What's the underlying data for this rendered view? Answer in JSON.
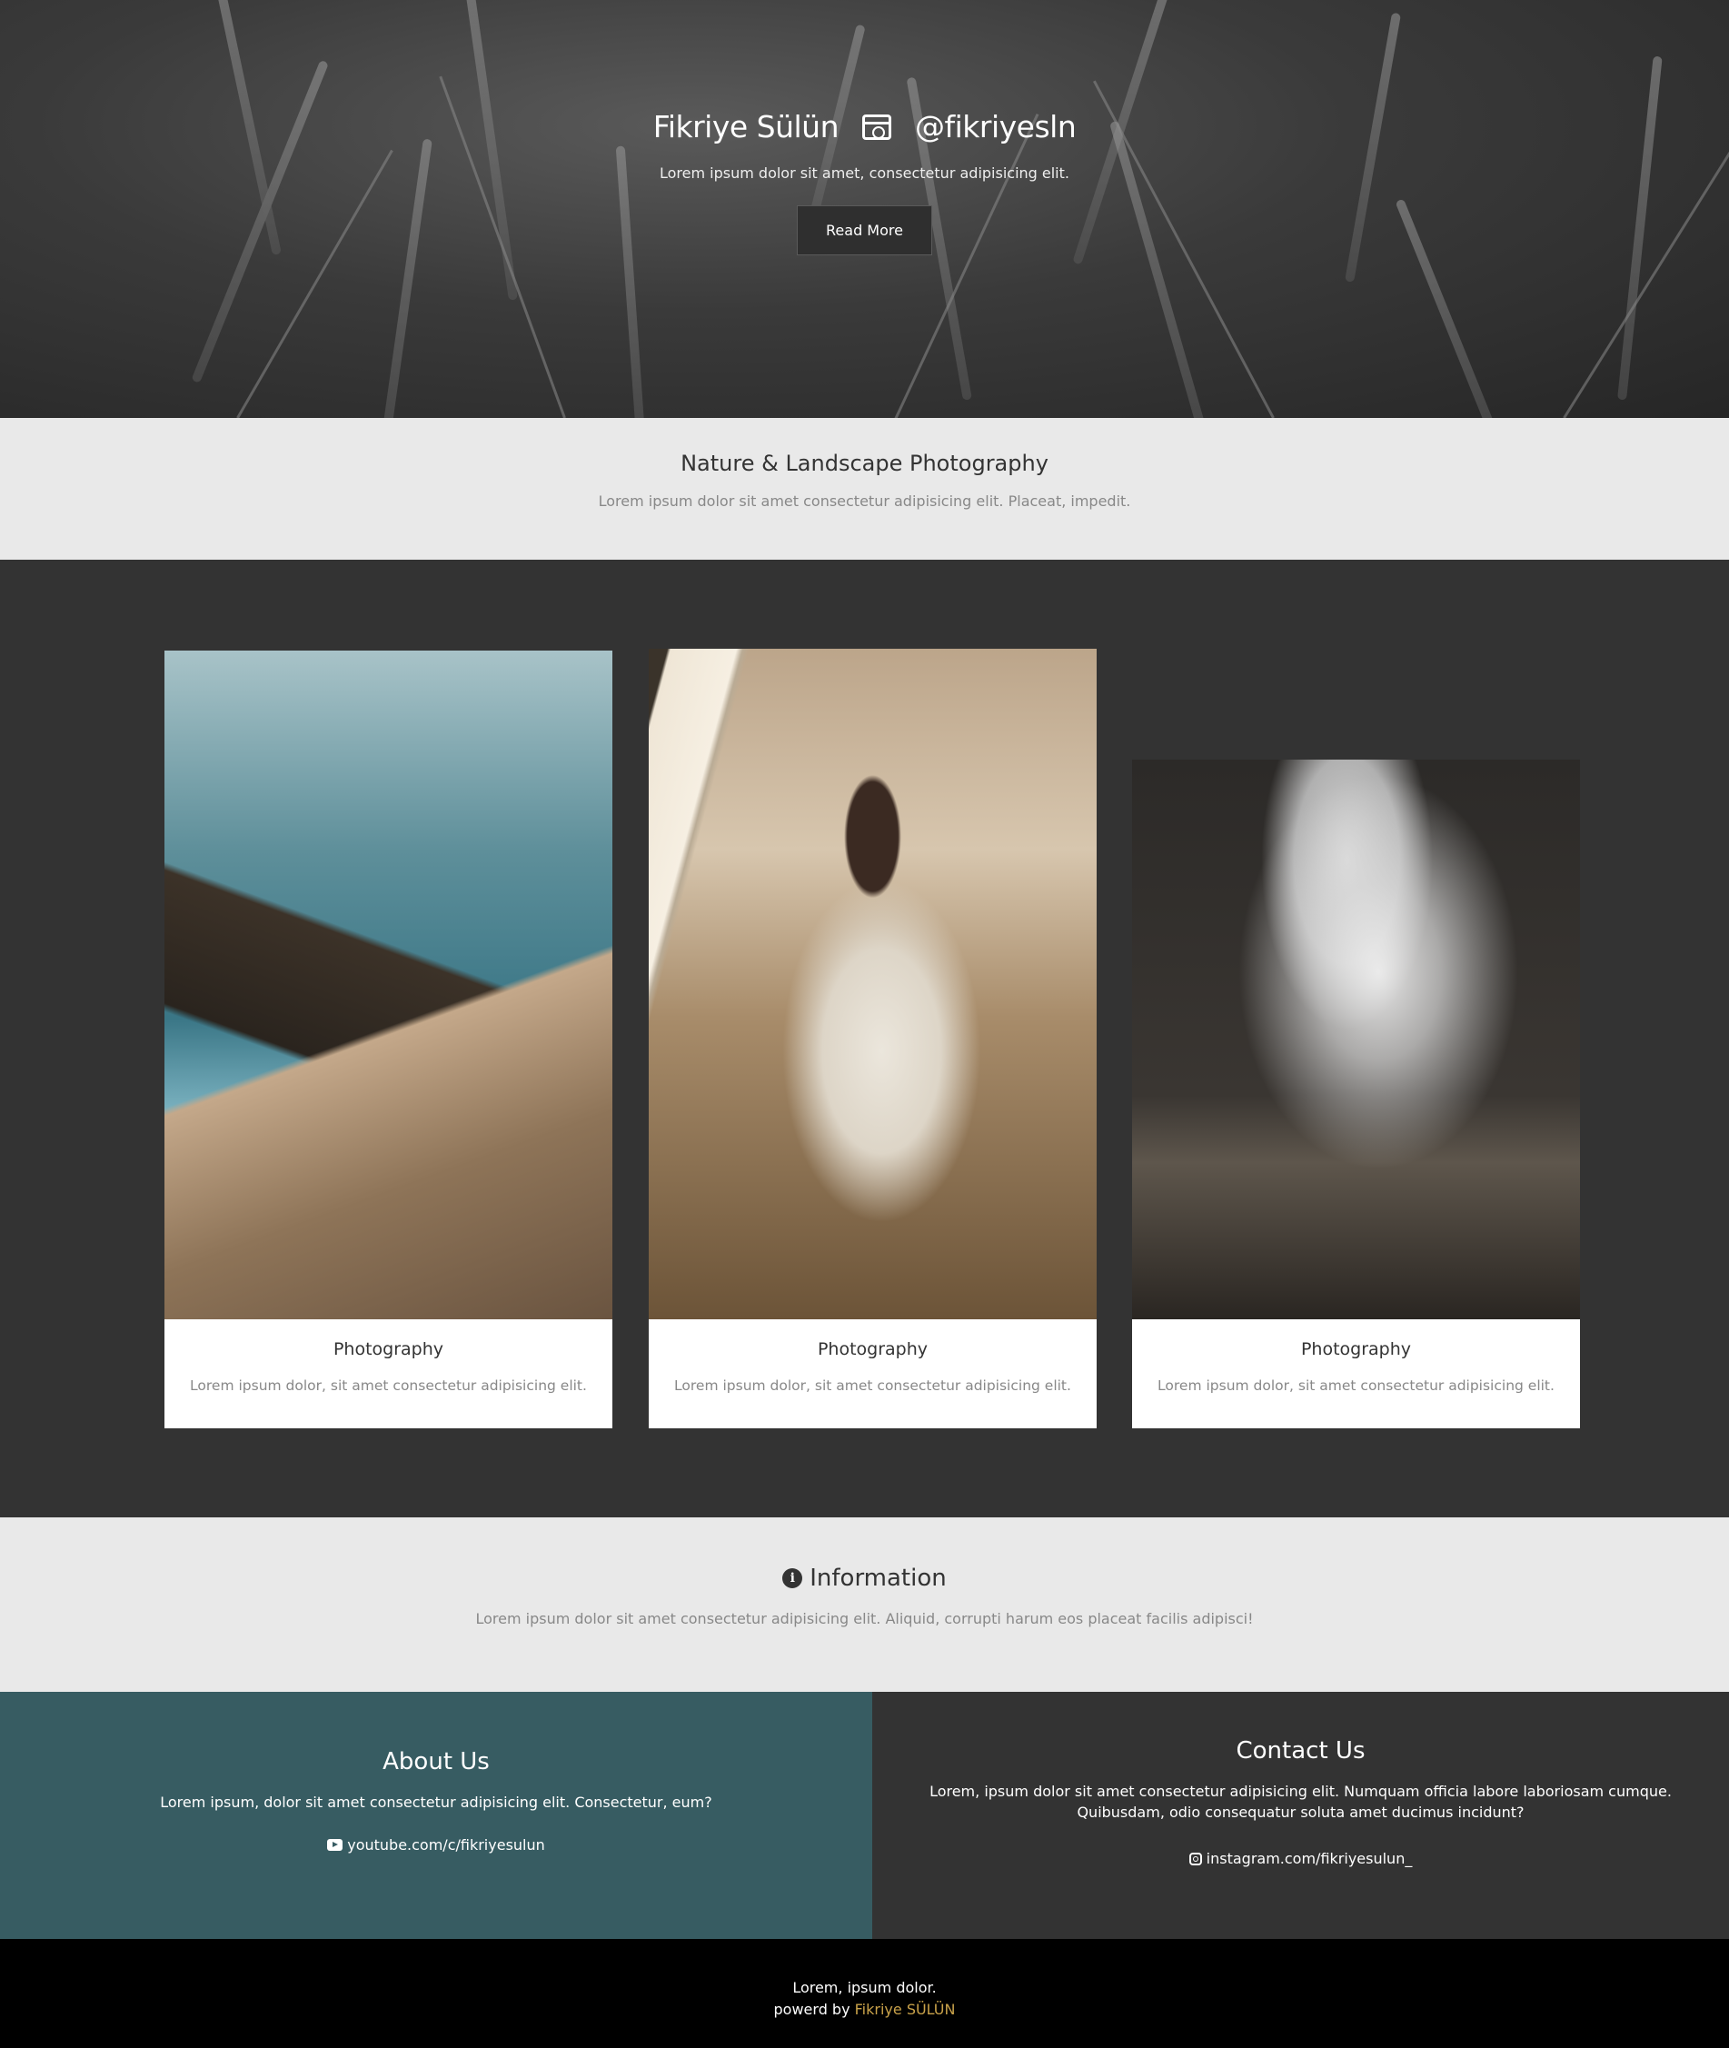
{
  "hero": {
    "name": "Fikriye Sülün",
    "handle": "@fikriyesln",
    "subtitle": "Lorem ipsum dolor sit amet, consectetur adipisicing elit.",
    "button": "Read More"
  },
  "intro": {
    "title": "Nature & Landscape Photography",
    "text": "Lorem ipsum dolor sit amet consectetur adipisicing elit. Placeat, impedit."
  },
  "cards": [
    {
      "title": "Photography",
      "text": "Lorem ipsum dolor, sit amet consectetur adipisicing elit."
    },
    {
      "title": "Photography",
      "text": "Lorem ipsum dolor, sit amet consectetur adipisicing elit."
    },
    {
      "title": "Photography",
      "text": "Lorem ipsum dolor, sit amet consectetur adipisicing elit."
    }
  ],
  "info": {
    "title": "Information",
    "text": "Lorem ipsum dolor sit amet consectetur adipisicing elit. Aliquid, corrupti harum eos placeat facilis adipisci!"
  },
  "about": {
    "title": "About Us",
    "text": "Lorem ipsum, dolor sit amet consectetur adipisicing elit. Consectetur, eum?",
    "link": "youtube.com/c/fikriyesulun"
  },
  "contact": {
    "title": "Contact Us",
    "text": "Lorem, ipsum dolor sit amet consectetur adipisicing elit. Numquam officia labore laboriosam cumque. Quibusdam, odio consequatur soluta amet ducimus incidunt?",
    "link": "instagram.com/fikriyesulun_"
  },
  "footer": {
    "line1": "Lorem, ipsum dolor.",
    "powered_prefix": "powerd by ",
    "brand": "Fikriye SÜLÜN"
  },
  "colors": {
    "about_bg": "#375c62",
    "brand_accent": "#c9a24a"
  }
}
